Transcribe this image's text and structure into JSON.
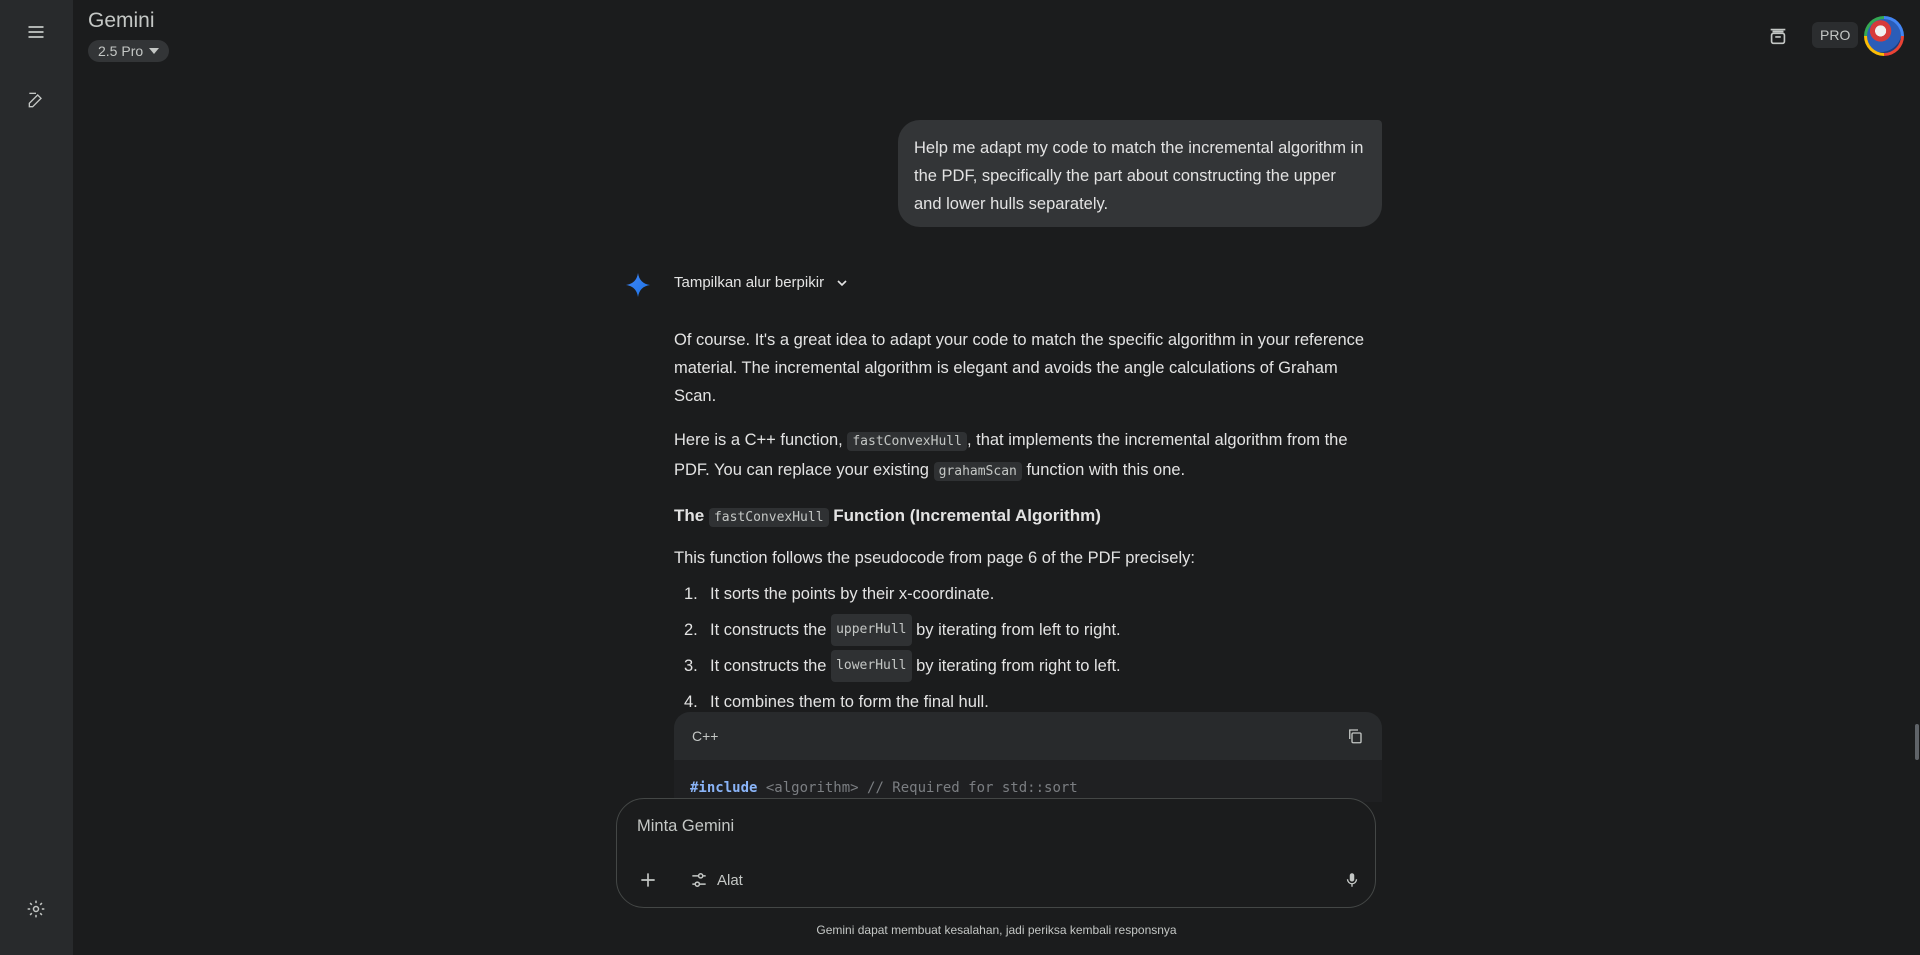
{
  "app": {
    "title": "Gemini",
    "model_label": "2.5 Pro",
    "pro_badge": "PRO"
  },
  "sidebar": {
    "menu_icon": "menu-icon",
    "new_chat_icon": "edit-icon",
    "settings_icon": "gear-icon"
  },
  "chat": {
    "user_message": "Help me adapt my code to match the incremental algorithm in the PDF, specifically the part about constructing the upper and lower hulls separately.",
    "thinking_toggle": "Tampilkan alur berpikir",
    "response": {
      "p1": "Of course. It's a great idea to adapt your code to match the specific algorithm in your reference material. The incremental algorithm is elegant and avoids the angle calculations of Graham Scan.",
      "p2_a": "Here is a C++ function,",
      "p2_code1": "fastConvexHull",
      "p2_b": ", that implements the incremental algorithm from the PDF. You can replace your existing",
      "p2_code2": "grahamScan",
      "p2_c": "function with this one.",
      "h_a": "The",
      "h_code": "fastConvexHull",
      "h_b": "Function (Incremental Algorithm)",
      "p3": "This function follows the pseudocode from page 6 of the PDF precisely:",
      "list": [
        {
          "num": "1.",
          "text_a": "It sorts the points by their x-coordinate.",
          "code": "",
          "text_b": ""
        },
        {
          "num": "2.",
          "text_a": "It constructs the",
          "code": "upperHull",
          "text_b": "by iterating from left to right."
        },
        {
          "num": "3.",
          "text_a": "It constructs the",
          "code": "lowerHull",
          "text_b": "by iterating from right to left."
        },
        {
          "num": "4.",
          "text_a": "It combines them to form the final hull.",
          "code": "",
          "text_b": ""
        }
      ],
      "code_lang": "C++",
      "code_line_kw": "#include",
      "code_line_rest": "<algorithm> // Required for std::sort"
    }
  },
  "input": {
    "placeholder": "Minta Gemini",
    "tools_label": "Alat"
  },
  "disclaimer": "Gemini dapat membuat kesalahan, jadi periksa kembali responsnya"
}
